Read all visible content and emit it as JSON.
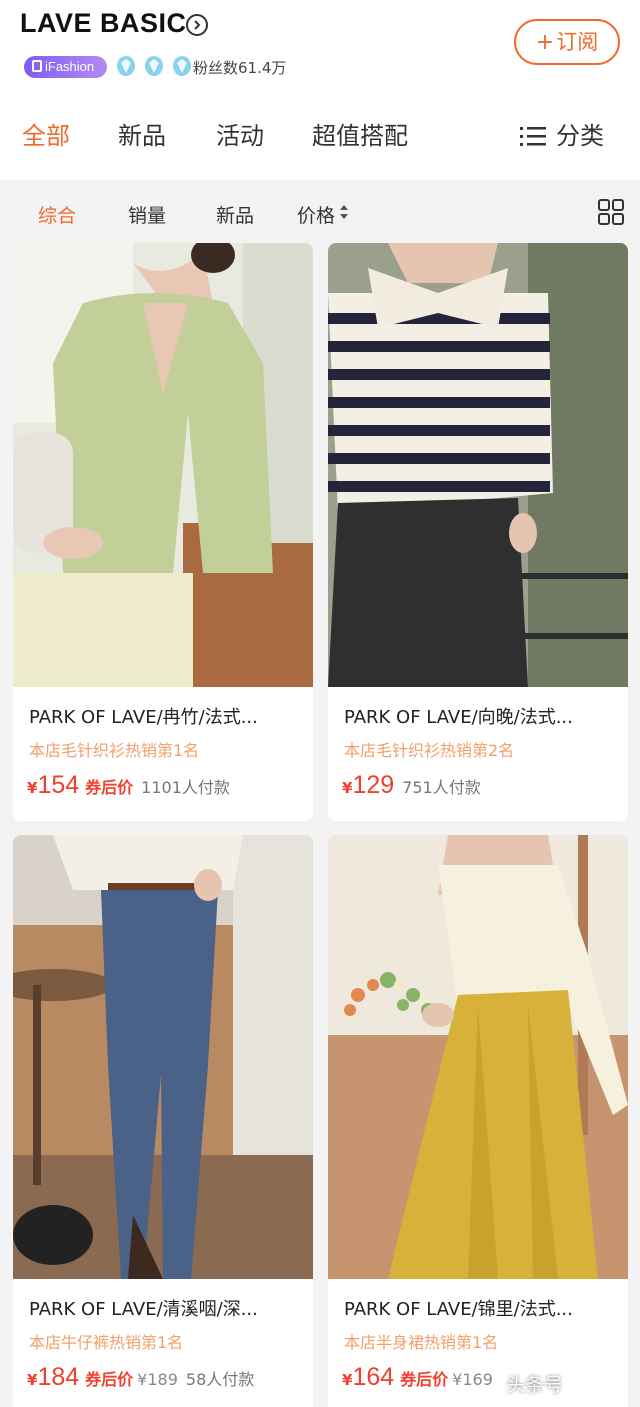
{
  "shop": {
    "name": "LAVE BASIC",
    "badge": "iFashion",
    "fans": "粉丝数61.4万",
    "subscribe_label": "订阅"
  },
  "tabs": [
    {
      "label": "全部",
      "active": true
    },
    {
      "label": "新品",
      "active": false
    },
    {
      "label": "活动",
      "active": false
    },
    {
      "label": "超值搭配",
      "active": false
    }
  ],
  "category_label": "分类",
  "filters": [
    {
      "label": "综合",
      "active": true
    },
    {
      "label": "销量",
      "active": false
    },
    {
      "label": "新品",
      "active": false
    },
    {
      "label": "价格",
      "active": false
    }
  ],
  "products": [
    {
      "title": "PARK OF LAVE/冉竹/法式...",
      "rank": "本店毛针织衫热销第1名",
      "yen": "¥",
      "price": "154",
      "coupon": "券后价",
      "orig": "",
      "sold": "1101人付款"
    },
    {
      "title": "PARK OF LAVE/向晚/法式...",
      "rank": "本店毛针织衫热销第2名",
      "yen": "¥",
      "price": "129",
      "coupon": "",
      "orig": "",
      "sold": "751人付款"
    },
    {
      "title": "PARK OF LAVE/清溪咽/深...",
      "rank": "本店牛仔裤热销第1名",
      "yen": "¥",
      "price": "184",
      "coupon": "券后价",
      "orig": "¥189",
      "sold": "58人付款"
    },
    {
      "title": "PARK OF LAVE/锦里/法式...",
      "rank": "本店半身裙热销第1名",
      "yen": "¥",
      "price": "164",
      "coupon": "券后价",
      "orig": "¥169",
      "sold": ""
    }
  ],
  "watermark": "头条号",
  "colors": {
    "accent": "#f06a2d",
    "price": "#f0402d",
    "rank": "#f3a06a"
  }
}
